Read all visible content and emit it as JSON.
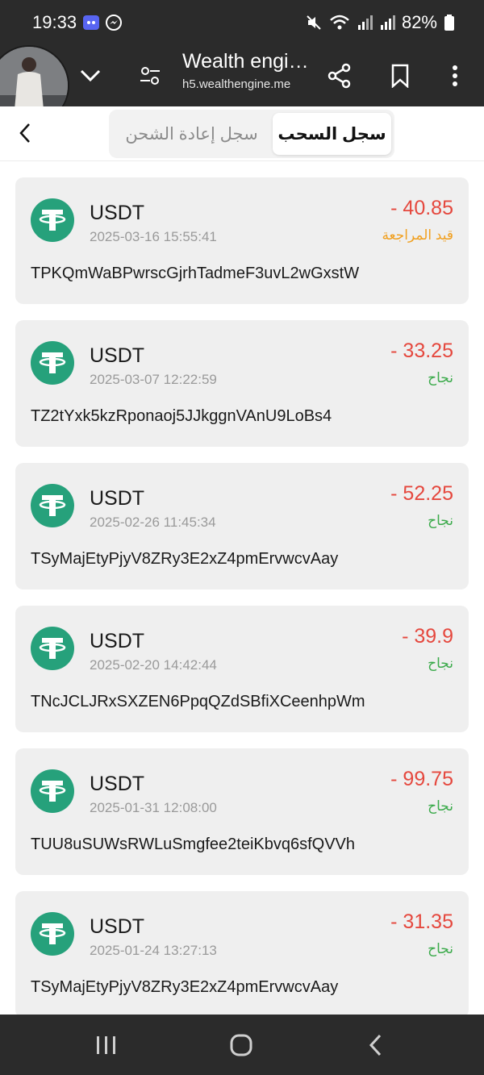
{
  "status_bar": {
    "time": "19:33",
    "battery": "82%",
    "icons": [
      "discord-icon",
      "messenger-icon",
      "mute-icon",
      "wifi-icon",
      "signal-icon",
      "signal-icon",
      "battery-icon"
    ]
  },
  "browser": {
    "title": "Wealth engi…",
    "url": "h5.wealthengine.me",
    "icons": [
      "chevron-down-icon",
      "tune-icon",
      "share-icon",
      "bookmark-icon",
      "more-icon"
    ]
  },
  "tabs": {
    "active": "سجل السحب",
    "inactive": "سجل إعادة الشحن"
  },
  "colors": {
    "amount": "#e5483e",
    "pending": "#f0a020",
    "success": "#3aaa4a",
    "coin": "#26a17b"
  },
  "records": [
    {
      "coin": "USDT",
      "date": "2025-03-16 15:55:41",
      "amount": "- 40.85",
      "status": "قيد المراجعة",
      "status_type": "pending",
      "address": "TPKQmWaBPwrscGjrhTadmeF3uvL2wGxstW"
    },
    {
      "coin": "USDT",
      "date": "2025-03-07 12:22:59",
      "amount": "- 33.25",
      "status": "نجاح",
      "status_type": "success",
      "address": "TZ2tYxk5kzRponaoj5JJkggnVAnU9LoBs4"
    },
    {
      "coin": "USDT",
      "date": "2025-02-26 11:45:34",
      "amount": "- 52.25",
      "status": "نجاح",
      "status_type": "success",
      "address": "TSyMajEtyPjyV8ZRy3E2xZ4pmErvwcvAay"
    },
    {
      "coin": "USDT",
      "date": "2025-02-20 14:42:44",
      "amount": "- 39.9",
      "status": "نجاح",
      "status_type": "success",
      "address": "TNcJCLJRxSXZEN6PpqQZdSBfiXCeenhpWm"
    },
    {
      "coin": "USDT",
      "date": "2025-01-31 12:08:00",
      "amount": "- 99.75",
      "status": "نجاح",
      "status_type": "success",
      "address": "TUU8uSUWsRWLuSmgfee2teiKbvq6sfQVVh"
    },
    {
      "coin": "USDT",
      "date": "2025-01-24 13:27:13",
      "amount": "- 31.35",
      "status": "نجاح",
      "status_type": "success",
      "address": "TSyMajEtyPjyV8ZRy3E2xZ4pmErvwcvAay"
    }
  ],
  "navbar": {
    "icons": [
      "recents-icon",
      "home-icon",
      "back-icon"
    ]
  }
}
